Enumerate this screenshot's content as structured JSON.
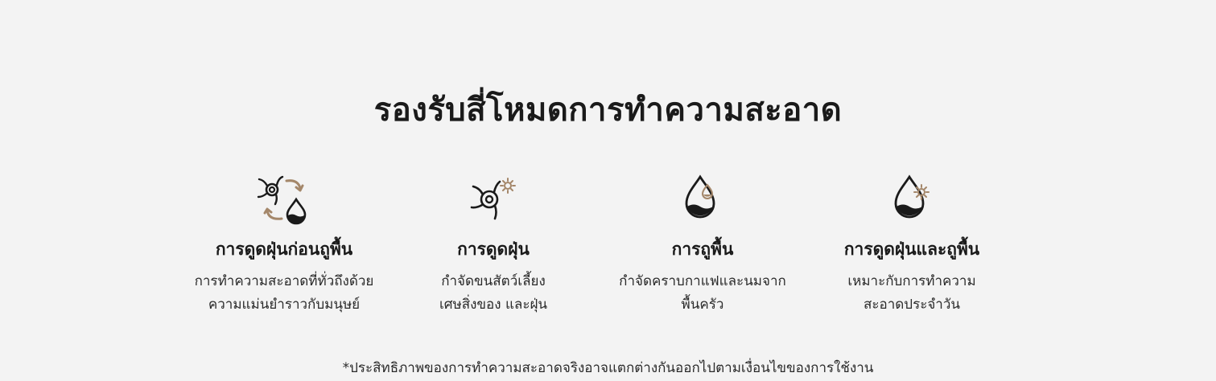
{
  "colors": {
    "icon_dark": "#1a1a1a",
    "icon_accent": "#a4876a",
    "background": "#f3f3f3"
  },
  "section": {
    "title": "รองรับสี่โหมดการทำความสะอาด"
  },
  "modes": [
    {
      "icon": "vacuum-then-mop-icon",
      "title": "การดูดฝุ่นก่อนถูพื้น",
      "desc_line1": "การทำความสะอาดที่ทั่วถึงด้วย",
      "desc_line2": "ความแม่นยำราวกับมนุษย์"
    },
    {
      "icon": "vacuum-icon",
      "title": "การดูดฝุ่น",
      "desc_line1": "กำจัดขนสัตว์เลี้ยง",
      "desc_line2": "เศษสิ่งของ และฝุ่น"
    },
    {
      "icon": "mop-icon",
      "title": "การถูพื้น",
      "desc_line1": "กำจัดคราบกาแฟและนมจาก",
      "desc_line2": "พื้นครัว"
    },
    {
      "icon": "vacuum-and-mop-icon",
      "title": "การดูดฝุ่นและถูพื้น",
      "desc_line1": "เหมาะกับการทำความ",
      "desc_line2": "สะอาดประจำวัน"
    }
  ],
  "footnote": "*ประสิทธิภาพของการทำความสะอาดจริงอาจแตกต่างกันออกไปตามเงื่อนไขของการใช้งาน"
}
